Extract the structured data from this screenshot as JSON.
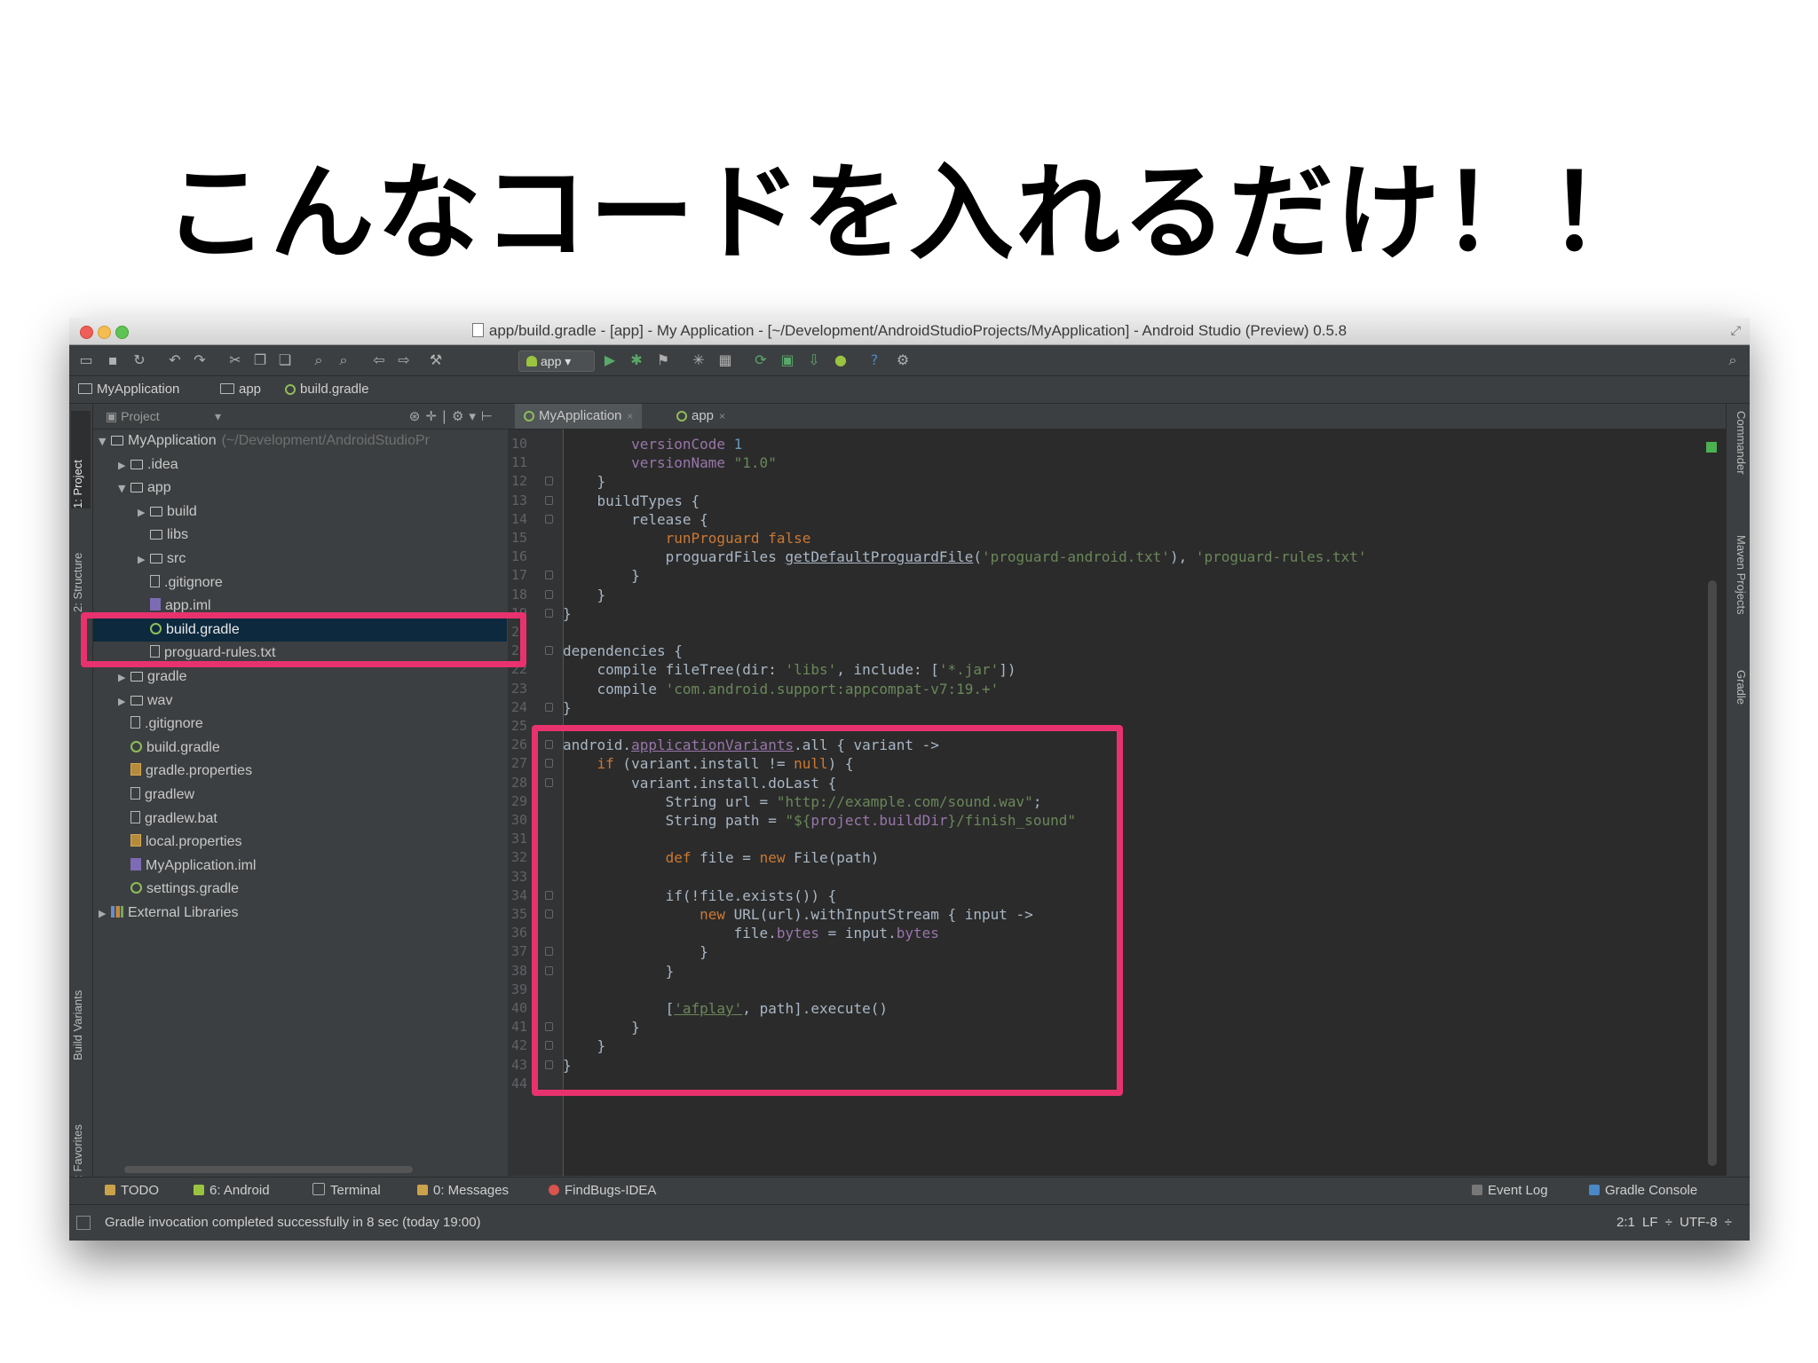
{
  "slide": {
    "title": "こんなコードを入れるだけ！！"
  },
  "window": {
    "title": "app/build.gradle - [app] - My Application - [~/Development/AndroidStudioProjects/MyApplication] - Android Studio (Preview) 0.5.8"
  },
  "toolbar": {
    "run_config": "app"
  },
  "navbar": {
    "crumbs": [
      "MyApplication",
      "app",
      "build.gradle"
    ]
  },
  "left_strip": {
    "project": "1: Project",
    "structure": "2: Structure",
    "build_variants": "Build Variants",
    "favorites": "2: Favorites"
  },
  "right_strip": {
    "commander": "Commander",
    "maven": "Maven Projects",
    "gradle": "Gradle"
  },
  "project_panel": {
    "header": "Project",
    "tree": [
      {
        "label": "MyApplication",
        "path": "(~/Development/AndroidStudioPr",
        "depth": 0,
        "arrow": "▼",
        "icon": "folder-icon"
      },
      {
        "label": ".idea",
        "depth": 1,
        "arrow": "▶",
        "icon": "folder-icon"
      },
      {
        "label": "app",
        "depth": 1,
        "arrow": "▼",
        "icon": "folder-icon"
      },
      {
        "label": "build",
        "depth": 2,
        "arrow": "▶",
        "icon": "folder-icon"
      },
      {
        "label": "libs",
        "depth": 2,
        "arrow": "",
        "icon": "folder-icon"
      },
      {
        "label": "src",
        "depth": 2,
        "arrow": "▶",
        "icon": "folder-icon"
      },
      {
        "label": ".gitignore",
        "depth": 2,
        "arrow": "",
        "icon": "file-icon"
      },
      {
        "label": "app.iml",
        "depth": 2,
        "arrow": "",
        "icon": "iml-icon"
      },
      {
        "label": "build.gradle",
        "depth": 2,
        "arrow": "",
        "icon": "gradle-icon",
        "selected": true
      },
      {
        "label": "proguard-rules.txt",
        "depth": 2,
        "arrow": "",
        "icon": "file-icon"
      },
      {
        "label": "gradle",
        "depth": 1,
        "arrow": "▶",
        "icon": "folder-icon"
      },
      {
        "label": "wav",
        "depth": 1,
        "arrow": "▶",
        "icon": "folder-icon"
      },
      {
        "label": ".gitignore",
        "depth": 1,
        "arrow": "",
        "icon": "file-icon"
      },
      {
        "label": "build.gradle",
        "depth": 1,
        "arrow": "",
        "icon": "gradle-icon"
      },
      {
        "label": "gradle.properties",
        "depth": 1,
        "arrow": "",
        "icon": "properties-icon"
      },
      {
        "label": "gradlew",
        "depth": 1,
        "arrow": "",
        "icon": "file-icon"
      },
      {
        "label": "gradlew.bat",
        "depth": 1,
        "arrow": "",
        "icon": "file-icon"
      },
      {
        "label": "local.properties",
        "depth": 1,
        "arrow": "",
        "icon": "properties-icon"
      },
      {
        "label": "MyApplication.iml",
        "depth": 1,
        "arrow": "",
        "icon": "iml-icon"
      },
      {
        "label": "settings.gradle",
        "depth": 1,
        "arrow": "",
        "icon": "gradle-icon"
      },
      {
        "label": "External Libraries",
        "depth": 0,
        "arrow": "▶",
        "icon": "library-icon"
      }
    ]
  },
  "editor": {
    "tabs": [
      "MyApplication",
      "app"
    ],
    "lines": [
      {
        "n": "10",
        "fold": false,
        "seg": [
          [
            "",
            "        "
          ],
          [
            "fld",
            "versionCode "
          ],
          [
            "num",
            "1"
          ]
        ]
      },
      {
        "n": "11",
        "fold": false,
        "seg": [
          [
            "",
            "        "
          ],
          [
            "fld",
            "versionName "
          ],
          [
            "str",
            "\"1.0\""
          ]
        ]
      },
      {
        "n": "12",
        "fold": true,
        "seg": [
          [
            "",
            "    }"
          ]
        ]
      },
      {
        "n": "13",
        "fold": true,
        "seg": [
          [
            "",
            "    buildTypes {"
          ]
        ]
      },
      {
        "n": "14",
        "fold": true,
        "seg": [
          [
            "",
            "        release {"
          ]
        ]
      },
      {
        "n": "15",
        "fold": false,
        "seg": [
          [
            "",
            "            "
          ],
          [
            "kw",
            "runProguard false"
          ]
        ]
      },
      {
        "n": "16",
        "fold": false,
        "seg": [
          [
            "",
            "            proguardFiles "
          ],
          [
            "ul",
            "getDefaultProguardFile"
          ],
          [
            "",
            "("
          ],
          [
            "str",
            "'proguard-android.txt'"
          ],
          [
            "",
            "), "
          ],
          [
            "str",
            "'proguard-rules.txt'"
          ]
        ]
      },
      {
        "n": "17",
        "fold": true,
        "seg": [
          [
            "",
            "        }"
          ]
        ]
      },
      {
        "n": "18",
        "fold": true,
        "seg": [
          [
            "",
            "    }"
          ]
        ]
      },
      {
        "n": "19",
        "fold": true,
        "seg": [
          [
            "",
            "}"
          ]
        ]
      },
      {
        "n": "20",
        "fold": false,
        "seg": [
          [
            "",
            ""
          ]
        ]
      },
      {
        "n": "21",
        "fold": true,
        "seg": [
          [
            "",
            "dependencies {"
          ]
        ]
      },
      {
        "n": "22",
        "fold": false,
        "seg": [
          [
            "",
            "    compile fileTree(dir: "
          ],
          [
            "str",
            "'libs'"
          ],
          [
            "",
            ", include: ["
          ],
          [
            "str",
            "'*.jar'"
          ],
          [
            "",
            "])"
          ]
        ]
      },
      {
        "n": "23",
        "fold": false,
        "seg": [
          [
            "",
            "    compile "
          ],
          [
            "str",
            "'com.android.support:appcompat-v7:19.+'"
          ]
        ]
      },
      {
        "n": "24",
        "fold": true,
        "seg": [
          [
            "",
            "}"
          ]
        ]
      },
      {
        "n": "25",
        "fold": false,
        "seg": [
          [
            "",
            ""
          ]
        ]
      },
      {
        "n": "26",
        "fold": true,
        "seg": [
          [
            "",
            "android."
          ],
          [
            "ful",
            "applicationVariants"
          ],
          [
            "",
            ".all { variant ->"
          ]
        ]
      },
      {
        "n": "27",
        "fold": true,
        "seg": [
          [
            "",
            "    "
          ],
          [
            "kw",
            "if"
          ],
          [
            "",
            " (variant.install != "
          ],
          [
            "kw",
            "null"
          ],
          [
            "",
            ") {"
          ]
        ]
      },
      {
        "n": "28",
        "fold": true,
        "seg": [
          [
            "",
            "        variant.install.doLast {"
          ]
        ]
      },
      {
        "n": "29",
        "fold": false,
        "seg": [
          [
            "",
            "            String url = "
          ],
          [
            "str",
            "\"http://example.com/sound.wav\""
          ],
          [
            "",
            ";"
          ]
        ]
      },
      {
        "n": "30",
        "fold": false,
        "seg": [
          [
            "",
            "            String path = "
          ],
          [
            "str",
            "\"${"
          ],
          [
            "fld",
            "project.buildDir"
          ],
          [
            "str",
            "}/finish_sound\""
          ]
        ]
      },
      {
        "n": "31",
        "fold": false,
        "seg": [
          [
            "",
            ""
          ]
        ]
      },
      {
        "n": "32",
        "fold": false,
        "seg": [
          [
            "",
            "            "
          ],
          [
            "kw",
            "def"
          ],
          [
            "",
            " file = "
          ],
          [
            "kw",
            "new"
          ],
          [
            "",
            " File(path)"
          ]
        ]
      },
      {
        "n": "33",
        "fold": false,
        "seg": [
          [
            "",
            ""
          ]
        ]
      },
      {
        "n": "34",
        "fold": true,
        "seg": [
          [
            "",
            "            if(!file.exists()) {"
          ]
        ]
      },
      {
        "n": "35",
        "fold": true,
        "seg": [
          [
            "",
            "                "
          ],
          [
            "kw",
            "new"
          ],
          [
            "",
            " URL(url).withInputStream { input ->"
          ]
        ]
      },
      {
        "n": "36",
        "fold": false,
        "seg": [
          [
            "",
            "                    file."
          ],
          [
            "fld",
            "bytes"
          ],
          [
            "",
            " = input."
          ],
          [
            "fld",
            "bytes"
          ]
        ]
      },
      {
        "n": "37",
        "fold": true,
        "seg": [
          [
            "",
            "                }"
          ]
        ]
      },
      {
        "n": "38",
        "fold": true,
        "seg": [
          [
            "",
            "            }"
          ]
        ]
      },
      {
        "n": "39",
        "fold": false,
        "seg": [
          [
            "",
            ""
          ]
        ]
      },
      {
        "n": "40",
        "fold": false,
        "seg": [
          [
            "",
            "            ["
          ],
          [
            "sul",
            "'afplay'"
          ],
          [
            "",
            ", path].execute()"
          ]
        ]
      },
      {
        "n": "41",
        "fold": true,
        "seg": [
          [
            "",
            "        }"
          ]
        ]
      },
      {
        "n": "42",
        "fold": true,
        "seg": [
          [
            "",
            "    }"
          ]
        ]
      },
      {
        "n": "43",
        "fold": true,
        "seg": [
          [
            "",
            "}"
          ]
        ]
      },
      {
        "n": "44",
        "fold": false,
        "seg": [
          [
            "",
            ""
          ]
        ]
      }
    ]
  },
  "bottom_tools": {
    "todo": "TODO",
    "android": "6: Android",
    "terminal": "Terminal",
    "messages": "0: Messages",
    "findbugs": "FindBugs-IDEA",
    "event_log": "Event Log",
    "gradle_console": "Gradle Console"
  },
  "status": {
    "message": "Gradle invocation completed successfully in 8 sec (today 19:00)",
    "right": "2:1   LF ÷   UTF-8 ÷"
  },
  "colors": {
    "highlight": "#e8326e",
    "keyword": "#cc7832",
    "string": "#6a8759",
    "field": "#9876aa",
    "number": "#6897bb"
  }
}
